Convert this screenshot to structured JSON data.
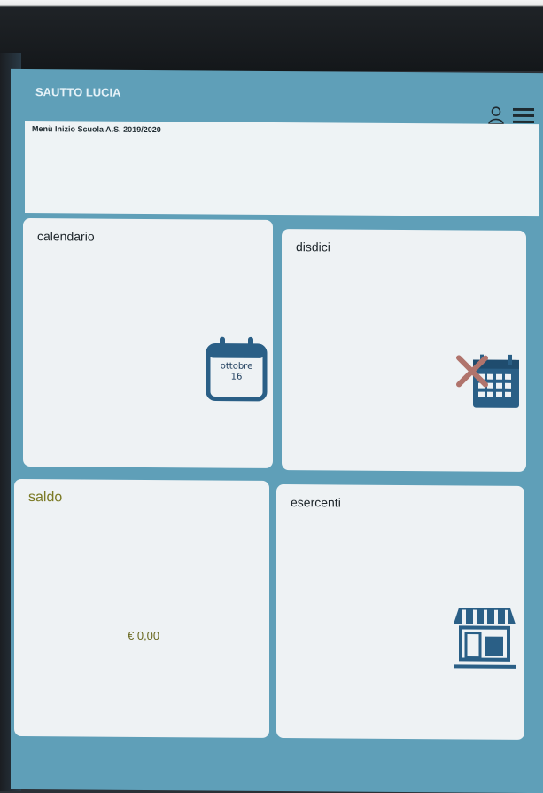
{
  "header": {
    "title": "SAUTTO LUCIA",
    "icons": [
      "user-icon",
      "hamburger-menu-icon"
    ]
  },
  "banner": {
    "text": "Menù Inizio Scuola A.S. 2019/2020"
  },
  "tiles": {
    "calendario": {
      "label": "calendario",
      "icon": "calendar-icon",
      "month": "ottobre",
      "day": "16"
    },
    "disdici": {
      "label": "disdici",
      "icon": "calendar-cancel-icon"
    },
    "saldo": {
      "label": "saldo",
      "value": "€ 0,00"
    },
    "esercenti": {
      "label": "esercenti",
      "icon": "shop-icon"
    }
  },
  "colors": {
    "app_background": "#5f9fb8",
    "tile_background": "#eef2f4",
    "icon_blue": "#2a5f86",
    "saldo_text": "#7b7a25",
    "cancel_red": "#b0746c"
  }
}
